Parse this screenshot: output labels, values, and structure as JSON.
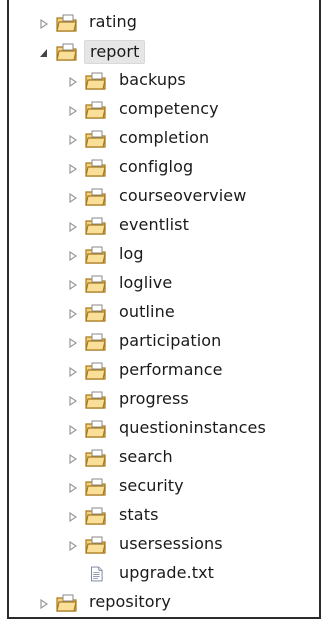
{
  "tree": {
    "top_items": [
      {
        "label": "rating",
        "expanded": false,
        "icon": "package-folder-icon"
      },
      {
        "label": "report",
        "expanded": true,
        "icon": "package-folder-icon",
        "selected": true
      }
    ],
    "report_children": [
      {
        "label": "backups"
      },
      {
        "label": "competency"
      },
      {
        "label": "completion"
      },
      {
        "label": "configlog"
      },
      {
        "label": "courseoverview"
      },
      {
        "label": "eventlist"
      },
      {
        "label": "log"
      },
      {
        "label": "loglive"
      },
      {
        "label": "outline"
      },
      {
        "label": "participation"
      },
      {
        "label": "performance"
      },
      {
        "label": "progress"
      },
      {
        "label": "questioninstances"
      },
      {
        "label": "search"
      },
      {
        "label": "security"
      },
      {
        "label": "stats"
      },
      {
        "label": "usersessions"
      }
    ],
    "file_item": {
      "label": "upgrade.txt",
      "icon": "text-file-icon"
    },
    "bottom_item": {
      "label": "repository",
      "expanded": false,
      "icon": "package-folder-icon"
    }
  },
  "colors": {
    "folder_fill": "#f6d27a",
    "folder_stroke": "#a87a1e",
    "arrow_collapsed": "#9a9a9a",
    "arrow_expanded": "#444444",
    "selection": "#e6e6e6"
  }
}
